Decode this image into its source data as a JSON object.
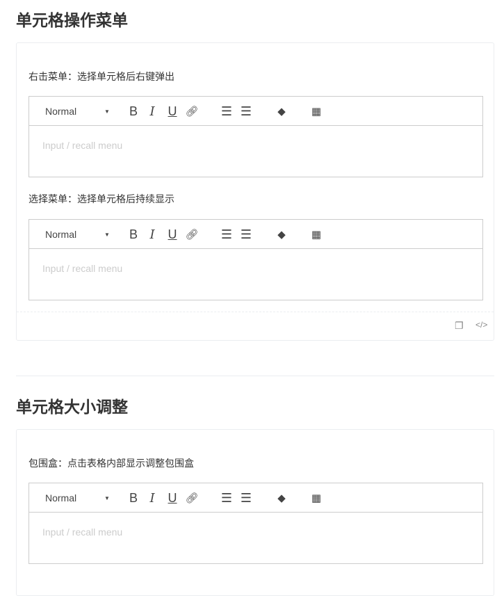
{
  "sections": [
    {
      "title": "单元格操作菜单",
      "demos": [
        {
          "label": "右击菜单：选择单元格后右键弹出",
          "editor": {
            "format": "Normal",
            "placeholder": "Input / recall menu"
          }
        },
        {
          "label": "选择菜单：选择单元格后持续显示",
          "editor": {
            "format": "Normal",
            "placeholder": "Input / recall menu"
          }
        }
      ]
    },
    {
      "title": "单元格大小调整",
      "demos": [
        {
          "label": "包围盒：点击表格内部显示调整包围盒",
          "editor": {
            "format": "Normal",
            "placeholder": "Input / recall menu"
          }
        }
      ]
    }
  ],
  "footer_icons": [
    "copy-icon",
    "code-icon"
  ]
}
